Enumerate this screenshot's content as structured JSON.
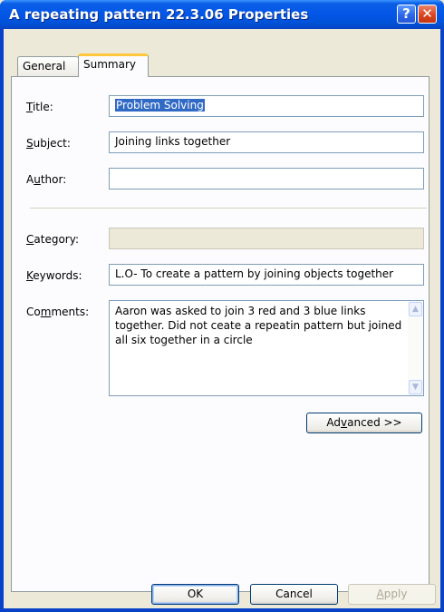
{
  "window": {
    "title": "A repeating pattern 22.3.06 Properties"
  },
  "titlebar": {
    "help_glyph": "?",
    "close_glyph": "✕"
  },
  "tabs": [
    {
      "label": "General",
      "selected": false
    },
    {
      "label": "Summary",
      "selected": true
    }
  ],
  "fields": {
    "title": {
      "label": "Title:",
      "mnemonic": "T",
      "rest": "itle:",
      "value": "Problem Solving"
    },
    "subject": {
      "label": "Subject:",
      "mnemonic": "S",
      "rest": "ubject:",
      "value": "Joining links together"
    },
    "author": {
      "label": "Author:",
      "pre": "A",
      "mnemonic": "u",
      "rest": "thor:",
      "value": ""
    },
    "category": {
      "label": "Category:",
      "mnemonic": "C",
      "rest": "ategory:",
      "value": ""
    },
    "keywords": {
      "label": "Keywords:",
      "mnemonic": "K",
      "rest": "eywords:",
      "value": "L.O- To create a pattern by joining objects together"
    },
    "comments": {
      "label": "Comments:",
      "pre": "Co",
      "mnemonic": "m",
      "rest": "ments:",
      "value": "Aaron was asked to join 3 red and 3 blue links together. Did not ceate a repeatin pattern but joined all six together in a circle"
    }
  },
  "buttons": {
    "advanced": {
      "pre": "Ad",
      "mnemonic": "v",
      "rest": "anced >>"
    },
    "ok": "OK",
    "cancel": "Cancel",
    "apply": {
      "mnemonic": "A",
      "rest": "pply"
    }
  },
  "colors": {
    "titlebar": "#0356e6",
    "selection": "#316ac5",
    "tab_highlight": "#ffc83c"
  }
}
